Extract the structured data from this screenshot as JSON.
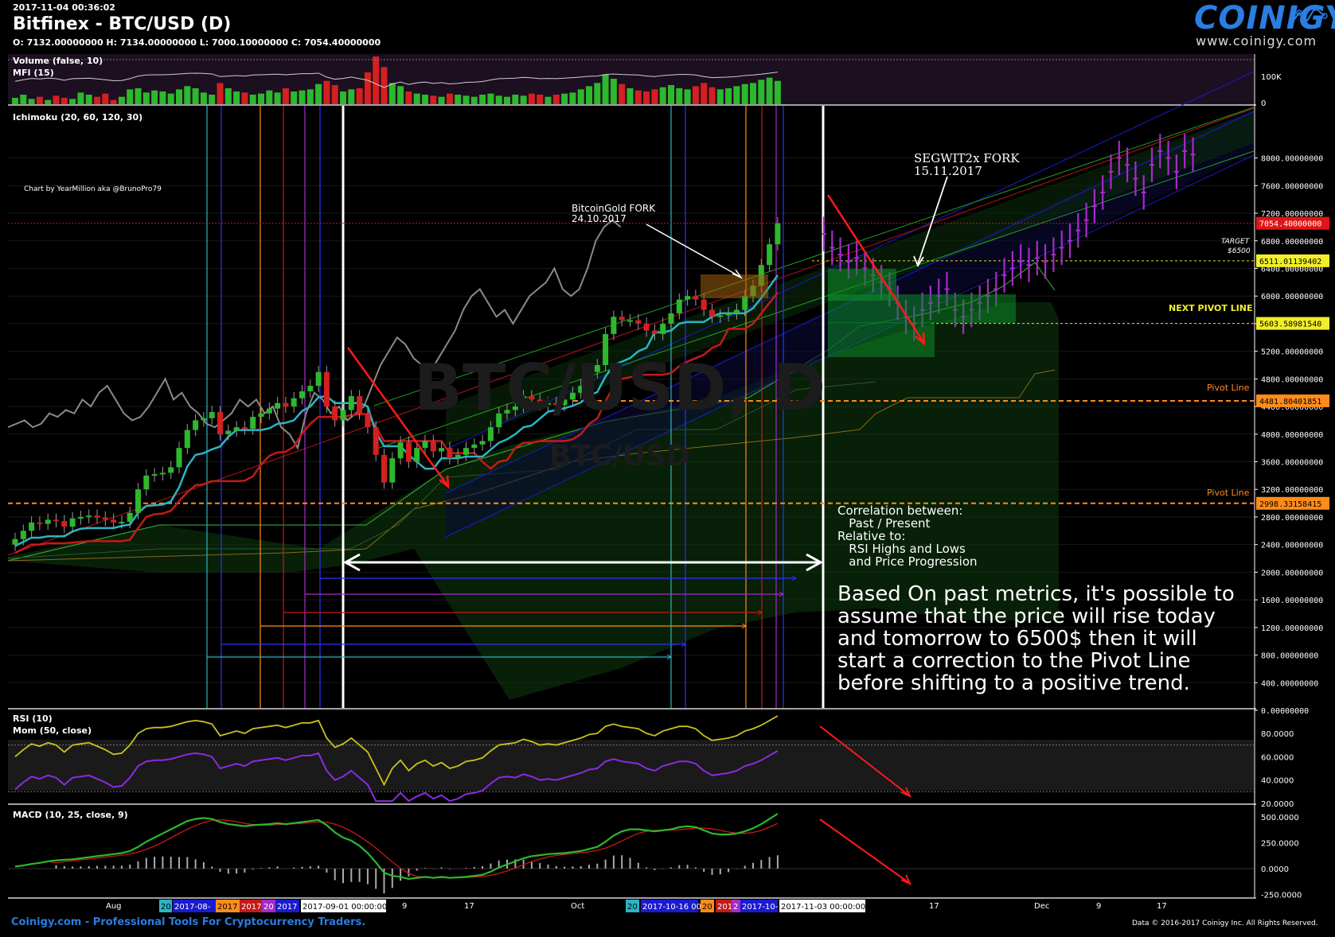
{
  "header": {
    "timestamp": "2017-11-04 00:36:02",
    "title": "Bitfinex - BTC/USD (D)",
    "ohlc": "O: 7132.00000000 H: 7134.00000000 L: 7000.10000000 C: 7054.40000000",
    "logo_text": "COINIGY",
    "logo_url": "www.coinigy.com"
  },
  "footer": {
    "left": "Coinigy.com - Professional Tools For Cryptocurrency Traders.",
    "right": "Data © 2016-2017 Coinigy Inc. All Rights Reserved."
  },
  "panels": {
    "volume": {
      "label1": "Volume (false, 10)",
      "label2": "MFI (15)",
      "ticks": [
        "100K",
        "0"
      ]
    },
    "main": {
      "label": "Ichimoku (20, 60, 120, 30)",
      "credit": "Chart by YearMillion aka @BrunoPro79",
      "watermark": "BTC/USD, D",
      "watermark2": "BTC/USD"
    },
    "rsi": {
      "label1": "RSI (10)",
      "label2": "Mom (50, close)",
      "ticks": [
        "80.0000",
        "60.0000",
        "40.0000",
        "20.0000"
      ]
    },
    "macd": {
      "label": "MACD (10, 25, close, 9)",
      "ticks": [
        "500.0000",
        "250.0000",
        "0.0000",
        "-250.0000"
      ]
    }
  },
  "annotations": {
    "segwit_1": "SEGWIT2x FORK",
    "segwit_2": "15.11.2017",
    "btg_1": "BitcoinGold FORK",
    "btg_2": "24.10.2017",
    "target_1": "TARGET",
    "target_2": "$6500",
    "next_pivot": "NEXT PIVOT LINE",
    "pivot_1": "Pivot Line",
    "pivot_2": "Pivot Line",
    "corr_lines": [
      "Correlation between:",
      "   Past / Present",
      "Relative to:",
      "   RSI Highs and Lows",
      "   and Price Progression"
    ],
    "big_lines": [
      "Based On past metrics, it's possible to",
      "assume that the price will rise today",
      "and tomorrow to 6500$ then it will",
      "start a correction to the Pivot Line",
      "before shifting to a positive trend."
    ]
  },
  "price_labels": {
    "current": "7054.40000000",
    "target": "6511.01139402",
    "next_pivot": "5603.58981540",
    "pivot_a": "4481.80401851",
    "pivot_b": "2998.33158415"
  },
  "date_axis": {
    "ticks": [
      "Aug",
      "9",
      "17",
      "Oct",
      "9",
      "17",
      "Dec",
      "9",
      "17"
    ],
    "chips": [
      "20",
      "2017-08-",
      "2017",
      "2017",
      "20",
      "2017",
      "2017-09-01 00:00:00",
      "20",
      "2017-10-16 00",
      "20",
      "201",
      "2",
      "2017-10-",
      "2017-11-03 00:00:00"
    ]
  },
  "colors": {
    "up": "#2db82d",
    "down": "#d42020",
    "tenkan": "#2ab5c5",
    "kijun": "#c51a1a",
    "projection": "#a62bc9",
    "pivot": "#ff8c1a",
    "target": "#e8e22a",
    "mfi": "#cfcfcf"
  },
  "chart_data": {
    "type": "candlestick",
    "exchange": "Bitfinex",
    "pair": "BTC/USD",
    "timeframe": "D",
    "y_ticks": [
      0,
      400,
      800,
      1200,
      1600,
      2000,
      2400,
      2800,
      3200,
      3600,
      4000,
      4400,
      4800,
      5200,
      5600,
      6000,
      6400,
      6800,
      7200,
      7600,
      8000
    ],
    "ylim": [
      0,
      8200
    ],
    "close_series": [
      2480,
      2600,
      2720,
      2700,
      2760,
      2740,
      2660,
      2780,
      2800,
      2820,
      2790,
      2760,
      2720,
      2730,
      2860,
      3200,
      3400,
      3420,
      3440,
      3520,
      3800,
      4060,
      4200,
      4230,
      4320,
      4000,
      4050,
      4100,
      4080,
      4250,
      4300,
      4370,
      4450,
      4400,
      4520,
      4620,
      4700,
      4900,
      4400,
      4200,
      4350,
      4550,
      4300,
      4100,
      3700,
      3300,
      3650,
      3880,
      3600,
      3800,
      3900,
      3750,
      3800,
      3650,
      3700,
      3800,
      3850,
      3900,
      4100,
      4300,
      4350,
      4400,
      4550,
      4500,
      4430,
      4450,
      4420,
      4500,
      4600,
      4700,
      4900,
      5000,
      5450,
      5700,
      5650,
      5650,
      5600,
      5500,
      5450,
      5600,
      5750,
      5950,
      6000,
      5950,
      5800,
      5700,
      5720,
      5750,
      5800,
      6000,
      6150,
      6450,
      6750,
      7054
    ],
    "projection": [
      6900,
      6700,
      6600,
      6500,
      6550,
      6400,
      6300,
      6200,
      6100,
      5900,
      5700,
      5600,
      5800,
      5900,
      6000,
      6100,
      5800,
      5700,
      5800,
      5900,
      6000,
      6100,
      6300,
      6400,
      6500,
      6450,
      6550,
      6500,
      6600,
      6700,
      6800,
      6950,
      7100,
      7300,
      7500,
      7800,
      8000,
      7900,
      7700,
      7500,
      7900,
      8100,
      8000,
      7800,
      8100,
      8050
    ],
    "volume": [
      12,
      18,
      10,
      14,
      8,
      16,
      12,
      10,
      22,
      18,
      14,
      20,
      8,
      14,
      28,
      30,
      22,
      26,
      24,
      20,
      28,
      34,
      30,
      22,
      18,
      40,
      30,
      24,
      22,
      18,
      20,
      26,
      22,
      30,
      24,
      26,
      28,
      38,
      44,
      36,
      24,
      28,
      30,
      60,
      90,
      70,
      40,
      34,
      24,
      20,
      18,
      16,
      14,
      20,
      18,
      16,
      14,
      18,
      20,
      16,
      14,
      18,
      16,
      20,
      18,
      14,
      18,
      20,
      22,
      28,
      34,
      40,
      56,
      48,
      38,
      30,
      26,
      24,
      28,
      32,
      36,
      30,
      28,
      34,
      40,
      32,
      28,
      30,
      34,
      38,
      40,
      46,
      50,
      44
    ],
    "rsi": [
      60,
      66,
      71,
      69,
      72,
      70,
      64,
      70,
      71,
      72,
      69,
      66,
      62,
      63,
      70,
      80,
      84,
      85,
      85,
      86,
      88,
      90,
      91,
      90,
      88,
      78,
      80,
      82,
      80,
      84,
      85,
      86,
      87,
      85,
      87,
      89,
      89,
      91,
      76,
      68,
      71,
      76,
      70,
      64,
      50,
      36,
      50,
      57,
      48,
      54,
      57,
      52,
      55,
      50,
      52,
      56,
      57,
      59,
      65,
      70,
      71,
      72,
      75,
      73,
      70,
      71,
      70,
      72,
      74,
      76,
      79,
      80,
      86,
      88,
      86,
      85,
      84,
      80,
      78,
      82,
      84,
      86,
      86,
      84,
      78,
      74,
      75,
      76,
      78,
      82,
      84,
      87,
      91,
      95
    ],
    "macd": [
      20,
      30,
      45,
      55,
      70,
      80,
      85,
      90,
      100,
      110,
      120,
      130,
      140,
      150,
      170,
      210,
      260,
      300,
      340,
      380,
      420,
      460,
      480,
      490,
      480,
      450,
      430,
      420,
      410,
      420,
      425,
      430,
      440,
      430,
      440,
      450,
      460,
      470,
      420,
      350,
      300,
      270,
      220,
      150,
      60,
      -40,
      -70,
      -80,
      -100,
      -90,
      -80,
      -90,
      -80,
      -90,
      -85,
      -80,
      -70,
      -60,
      -30,
      10,
      40,
      70,
      100,
      120,
      130,
      140,
      145,
      150,
      160,
      170,
      190,
      210,
      260,
      320,
      360,
      380,
      380,
      370,
      360,
      370,
      380,
      400,
      410,
      400,
      370,
      340,
      330,
      330,
      340,
      360,
      390,
      430,
      480,
      530
    ]
  }
}
